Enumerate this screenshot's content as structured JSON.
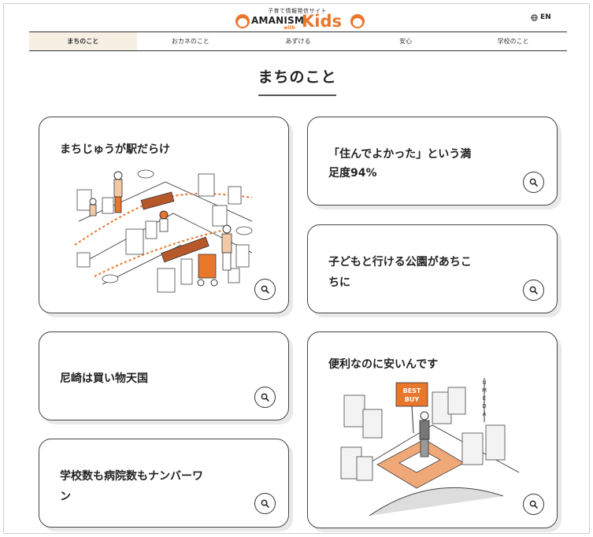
{
  "header": {
    "tagline": "子育て情報発信サイト",
    "brand": "AMANISM",
    "with": "with",
    "kids": "Kids",
    "lang_label": "EN"
  },
  "nav": {
    "tabs": [
      {
        "label": "まちのこと",
        "active": true
      },
      {
        "label": "おカネのこと",
        "active": false
      },
      {
        "label": "あずける",
        "active": false
      },
      {
        "label": "安心",
        "active": false
      },
      {
        "label": "学校のこと",
        "active": false
      }
    ]
  },
  "page": {
    "title": "まちのこと"
  },
  "cards": [
    {
      "line1": "まちじゅうが駅だらけ",
      "line2": ""
    },
    {
      "line1": "「住んでよかった」という満",
      "line2": "足度94%"
    },
    {
      "line1": "子どもと行ける公園があちこ",
      "line2": "ちに"
    },
    {
      "line1": "尼崎は買い物天国",
      "line2": ""
    },
    {
      "line1": "便利なのに安いんです",
      "line2": "",
      "sign1": "BEST",
      "sign2": "BUY",
      "vertical": [
        "U",
        "M",
        "E",
        "D",
        "A"
      ]
    },
    {
      "line1": "学校数も病院数もナンバーワ",
      "line2": "ン"
    }
  ],
  "colors": {
    "accent": "#e8762b",
    "text": "#222222",
    "nav_active_bg": "#f5efe4"
  },
  "icons": {
    "zoom": "magnifier-icon",
    "lang": "globe-icon"
  }
}
